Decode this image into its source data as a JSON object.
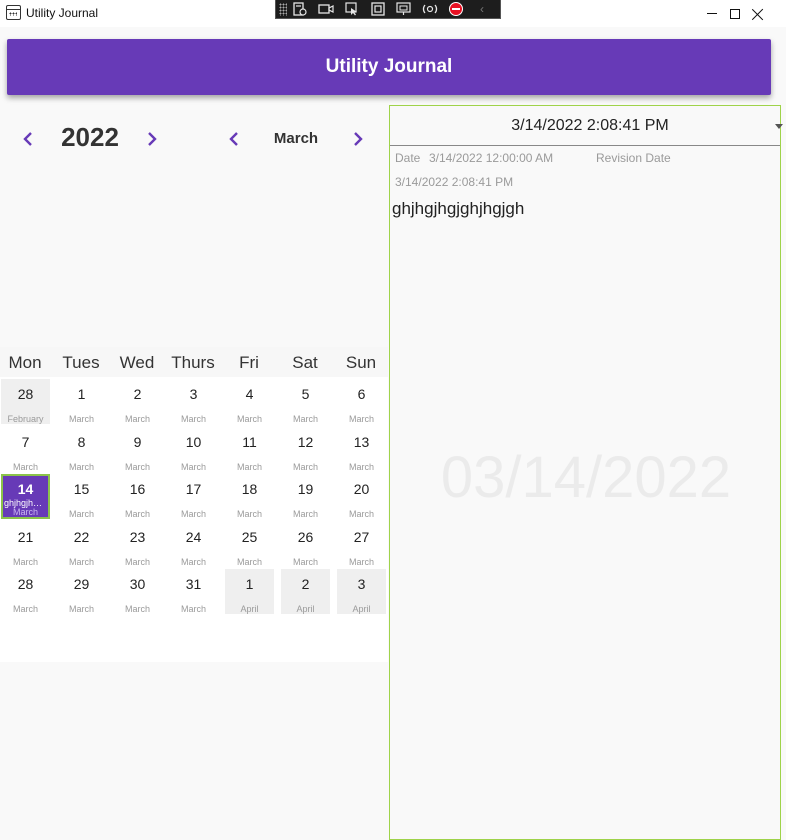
{
  "window": {
    "title": "Utility Journal",
    "icon": "calendar-icon"
  },
  "devtools": {
    "buttons": [
      "live-visual-tree-icon",
      "record-icon",
      "select-element-icon",
      "display-layout-adorners-icon",
      "track-focus-icon",
      "hot-reload-icon",
      "stop-icon",
      "collapse-chevron-icon"
    ]
  },
  "header": {
    "title": "Utility Journal",
    "color": "#673ab7"
  },
  "nav": {
    "year": "2022",
    "month": "March"
  },
  "calendar": {
    "weekdays": [
      "Mon",
      "Tues",
      "Wed",
      "Thurs",
      "Fri",
      "Sat",
      "Sun"
    ],
    "weeks": [
      [
        {
          "day": "28",
          "month": "February",
          "other": true
        },
        {
          "day": "1",
          "month": "March"
        },
        {
          "day": "2",
          "month": "March"
        },
        {
          "day": "3",
          "month": "March"
        },
        {
          "day": "4",
          "month": "March"
        },
        {
          "day": "5",
          "month": "March"
        },
        {
          "day": "6",
          "month": "March"
        }
      ],
      [
        {
          "day": "7",
          "month": "March"
        },
        {
          "day": "8",
          "month": "March"
        },
        {
          "day": "9",
          "month": "March"
        },
        {
          "day": "10",
          "month": "March"
        },
        {
          "day": "11",
          "month": "March"
        },
        {
          "day": "12",
          "month": "March"
        },
        {
          "day": "13",
          "month": "March"
        }
      ],
      [
        {
          "day": "14",
          "month": "March",
          "selected": true,
          "note": "ghjhgjhgjg..."
        },
        {
          "day": "15",
          "month": "March"
        },
        {
          "day": "16",
          "month": "March"
        },
        {
          "day": "17",
          "month": "March"
        },
        {
          "day": "18",
          "month": "March"
        },
        {
          "day": "19",
          "month": "March"
        },
        {
          "day": "20",
          "month": "March"
        }
      ],
      [
        {
          "day": "21",
          "month": "March"
        },
        {
          "day": "22",
          "month": "March"
        },
        {
          "day": "23",
          "month": "March"
        },
        {
          "day": "24",
          "month": "March"
        },
        {
          "day": "25",
          "month": "March"
        },
        {
          "day": "26",
          "month": "March"
        },
        {
          "day": "27",
          "month": "March"
        }
      ],
      [
        {
          "day": "28",
          "month": "March"
        },
        {
          "day": "29",
          "month": "March"
        },
        {
          "day": "30",
          "month": "March"
        },
        {
          "day": "31",
          "month": "March"
        },
        {
          "day": "1",
          "month": "April",
          "other": true
        },
        {
          "day": "2",
          "month": "April",
          "other": true
        },
        {
          "day": "3",
          "month": "April",
          "other": true
        }
      ]
    ]
  },
  "entry": {
    "revision_selected": "3/14/2022 2:08:41 PM",
    "date_label": "Date",
    "date_value": "3/14/2022 12:00:00 AM",
    "revision_label": "Revision Date",
    "revision_value": "3/14/2022 2:08:41 PM",
    "text": "ghjhgjhgjghjhgjgh",
    "watermark": "03/14/2022"
  },
  "colors": {
    "accent": "#673ab7",
    "selection_border": "#8bc34a",
    "panel_border": "#9fd34a"
  }
}
